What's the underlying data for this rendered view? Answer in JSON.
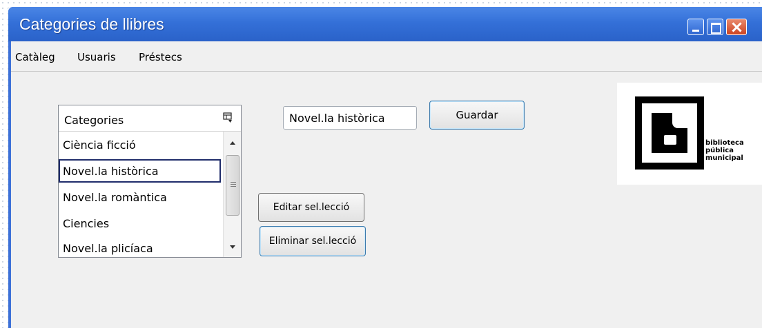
{
  "window": {
    "title": "Categories de llibres",
    "controls": [
      "minimize",
      "maximize",
      "close"
    ]
  },
  "menu": {
    "items": [
      "Catàleg",
      "Usuaris",
      "Préstecs"
    ]
  },
  "category_list": {
    "header": "Categories",
    "items": [
      "Ciència ficció",
      "Novel.la històrica",
      "Novel.la romàntica",
      "Ciencies",
      "Novel.la plicíaca"
    ],
    "selected_item": "Novel.la històrica"
  },
  "editor": {
    "input_value": "Novel.la històrica",
    "save_label": "Guardar"
  },
  "actions": {
    "edit_label": "Editar sel.lecció",
    "delete_label": "Eliminar sel.lecció"
  },
  "logo": {
    "line1": "biblioteca",
    "line2": "pública",
    "line3": "municipal"
  },
  "colors": {
    "titlebar": "#3470d8",
    "window_bg": "#f0f0f0",
    "selection_border": "#1f2c6b"
  }
}
